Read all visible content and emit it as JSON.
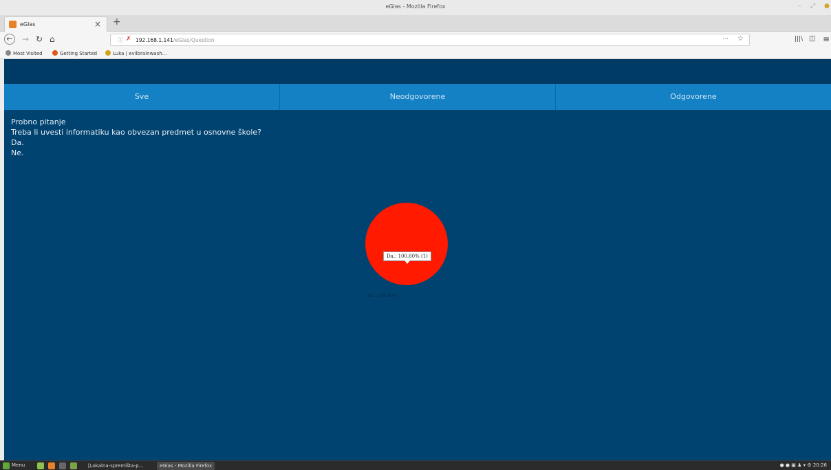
{
  "window": {
    "title": "eGlas - Mozilla Firefox",
    "controls": [
      "–",
      "⤢",
      "●"
    ]
  },
  "browser": {
    "tab_title": "eGlas",
    "tab_close": "×",
    "new_tab": "+",
    "url_host": "192.168.1.141",
    "url_path": "/eGlas/Question",
    "url_actions": "···",
    "bookmark_star": "☆",
    "pocket": "▽",
    "bookmarks": [
      {
        "label": "Most Visited",
        "color": "#888888"
      },
      {
        "label": "Getting Started",
        "color": "#e0561e"
      },
      {
        "label": "Luka | evilbrainwash...",
        "color": "#d4a017"
      }
    ]
  },
  "page": {
    "tabs": [
      "Sve",
      "Neodgovorene",
      "Odgovorene"
    ],
    "question_title": "Probno pitanje",
    "question_text": "Treba li uvesti informatiku kao obvezan predmet u osnovne škole?",
    "answers": [
      "Da.",
      "Ne."
    ]
  },
  "chart_data": {
    "type": "pie",
    "categories": [
      "Da.",
      "Ne."
    ],
    "values": [
      1,
      0
    ],
    "colors": [
      "#ff1a00",
      "#004370"
    ],
    "tooltip": "Da.: 100.00% (1)",
    "legend_label": "Da. : 100.00%"
  },
  "taskbar": {
    "menu": "Menu",
    "windows": [
      "[Lokalna-spremišta-p...",
      "eGlas - Mozilla Firefox"
    ],
    "clock": "20:26"
  }
}
